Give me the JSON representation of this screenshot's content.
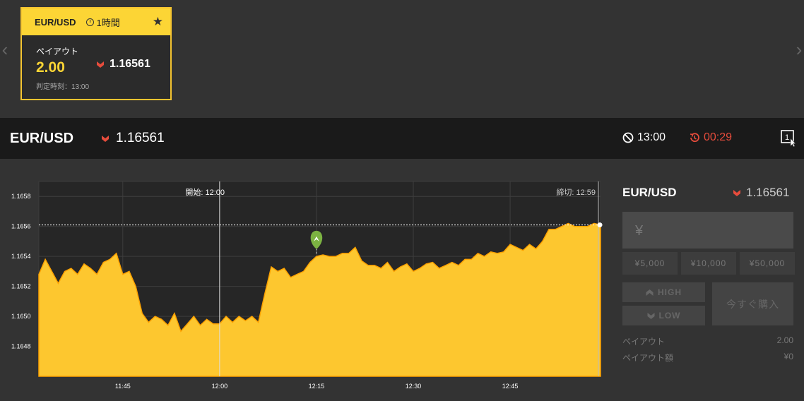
{
  "card": {
    "pair": "EUR/USD",
    "period": "1時間",
    "payout_label": "ペイアウト",
    "payout_value": "2.00",
    "rate": "1.16561",
    "judge_time": "判定時刻：13:00"
  },
  "header": {
    "pair": "EUR/USD",
    "rate": "1.16561",
    "expiry": "13:00",
    "countdown": "00:29"
  },
  "chart_data": {
    "type": "area",
    "start_label": "開始: 12:00",
    "end_label": "締切: 12:59",
    "xticks": [
      "11:45",
      "12:00",
      "12:15",
      "12:30",
      "12:45"
    ],
    "yticks": [
      "1.1658",
      "1.1656",
      "1.1654",
      "1.1652",
      "1.1650",
      "1.1648"
    ],
    "ylim": [
      1.1646,
      1.1659
    ],
    "current_rate": 1.16561,
    "fill_color": "#fdc72f",
    "series": [
      {
        "x": [
          "11:32",
          "11:33",
          "11:34",
          "11:35",
          "11:36",
          "11:37",
          "11:38",
          "11:39",
          "11:40",
          "11:41",
          "11:42",
          "11:43",
          "11:44",
          "11:45",
          "11:46",
          "11:47",
          "11:48",
          "11:49",
          "11:50",
          "11:51",
          "11:52",
          "11:53",
          "11:54",
          "11:55",
          "11:56",
          "11:57",
          "11:58",
          "11:59",
          "12:00",
          "12:01",
          "12:02",
          "12:03",
          "12:04",
          "12:05",
          "12:06",
          "12:07",
          "12:08",
          "12:09",
          "12:10",
          "12:11",
          "12:12",
          "12:13",
          "12:14",
          "12:15",
          "12:16",
          "12:17",
          "12:18",
          "12:19",
          "12:20",
          "12:21",
          "12:22",
          "12:23",
          "12:24",
          "12:25",
          "12:26",
          "12:27",
          "12:28",
          "12:29",
          "12:30",
          "12:31",
          "12:32",
          "12:33",
          "12:34",
          "12:35",
          "12:36",
          "12:37",
          "12:38",
          "12:39",
          "12:40",
          "12:41",
          "12:42",
          "12:43",
          "12:44",
          "12:45",
          "12:46",
          "12:47",
          "12:48",
          "12:49",
          "12:50",
          "12:51",
          "12:52",
          "12:53",
          "12:54",
          "12:55",
          "12:56",
          "12:57",
          "12:58",
          "12:59"
        ],
        "values": [
          1.16528,
          1.16538,
          1.1653,
          1.16522,
          1.1653,
          1.16532,
          1.16528,
          1.16535,
          1.16532,
          1.16528,
          1.16536,
          1.16538,
          1.16542,
          1.16528,
          1.1653,
          1.1652,
          1.16502,
          1.16496,
          1.165,
          1.16498,
          1.16494,
          1.16502,
          1.1649,
          1.16495,
          1.165,
          1.16494,
          1.16498,
          1.16495,
          1.16495,
          1.165,
          1.16496,
          1.165,
          1.16497,
          1.165,
          1.16496,
          1.16515,
          1.16533,
          1.1653,
          1.16532,
          1.16526,
          1.16528,
          1.1653,
          1.16536,
          1.1654,
          1.16541,
          1.1654,
          1.1654,
          1.16542,
          1.16542,
          1.16546,
          1.16537,
          1.16534,
          1.16534,
          1.16532,
          1.16536,
          1.1653,
          1.16533,
          1.16535,
          1.1653,
          1.16532,
          1.16535,
          1.16536,
          1.16532,
          1.16534,
          1.16536,
          1.16534,
          1.16538,
          1.16538,
          1.16542,
          1.1654,
          1.16543,
          1.16542,
          1.16543,
          1.16548,
          1.16546,
          1.16544,
          1.16548,
          1.16545,
          1.1655,
          1.16558,
          1.16558,
          1.1656,
          1.16562,
          1.1656,
          1.1656,
          1.1656,
          1.16562,
          1.16561
        ]
      }
    ],
    "marker": {
      "x": "12:15",
      "y": 1.16542
    }
  },
  "side": {
    "pair": "EUR/USD",
    "rate": "1.16561",
    "amount_placeholder": "¥",
    "presets": [
      "¥5,000",
      "¥10,000",
      "¥50,000"
    ],
    "high_label": "HIGH",
    "low_label": "LOW",
    "buy_now": "今すぐ購入",
    "payout_label": "ペイアウト",
    "payout_value": "2.00",
    "payout_amount_label": "ペイアウト額",
    "payout_amount_value": "¥0"
  },
  "colors": {
    "accent": "#fcd535",
    "down": "#e74c3c",
    "marker": "#7cb342"
  }
}
